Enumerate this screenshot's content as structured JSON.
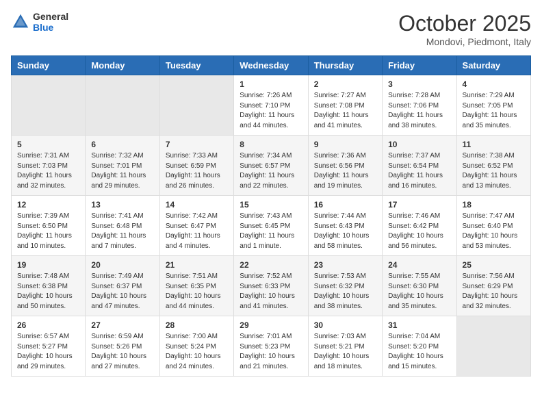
{
  "header": {
    "logo_general": "General",
    "logo_blue": "Blue",
    "month_title": "October 2025",
    "location": "Mondovi, Piedmont, Italy"
  },
  "days_of_week": [
    "Sunday",
    "Monday",
    "Tuesday",
    "Wednesday",
    "Thursday",
    "Friday",
    "Saturday"
  ],
  "weeks": [
    [
      {
        "num": "",
        "info": ""
      },
      {
        "num": "",
        "info": ""
      },
      {
        "num": "",
        "info": ""
      },
      {
        "num": "1",
        "info": "Sunrise: 7:26 AM\nSunset: 7:10 PM\nDaylight: 11 hours and 44 minutes."
      },
      {
        "num": "2",
        "info": "Sunrise: 7:27 AM\nSunset: 7:08 PM\nDaylight: 11 hours and 41 minutes."
      },
      {
        "num": "3",
        "info": "Sunrise: 7:28 AM\nSunset: 7:06 PM\nDaylight: 11 hours and 38 minutes."
      },
      {
        "num": "4",
        "info": "Sunrise: 7:29 AM\nSunset: 7:05 PM\nDaylight: 11 hours and 35 minutes."
      }
    ],
    [
      {
        "num": "5",
        "info": "Sunrise: 7:31 AM\nSunset: 7:03 PM\nDaylight: 11 hours and 32 minutes."
      },
      {
        "num": "6",
        "info": "Sunrise: 7:32 AM\nSunset: 7:01 PM\nDaylight: 11 hours and 29 minutes."
      },
      {
        "num": "7",
        "info": "Sunrise: 7:33 AM\nSunset: 6:59 PM\nDaylight: 11 hours and 26 minutes."
      },
      {
        "num": "8",
        "info": "Sunrise: 7:34 AM\nSunset: 6:57 PM\nDaylight: 11 hours and 22 minutes."
      },
      {
        "num": "9",
        "info": "Sunrise: 7:36 AM\nSunset: 6:56 PM\nDaylight: 11 hours and 19 minutes."
      },
      {
        "num": "10",
        "info": "Sunrise: 7:37 AM\nSunset: 6:54 PM\nDaylight: 11 hours and 16 minutes."
      },
      {
        "num": "11",
        "info": "Sunrise: 7:38 AM\nSunset: 6:52 PM\nDaylight: 11 hours and 13 minutes."
      }
    ],
    [
      {
        "num": "12",
        "info": "Sunrise: 7:39 AM\nSunset: 6:50 PM\nDaylight: 11 hours and 10 minutes."
      },
      {
        "num": "13",
        "info": "Sunrise: 7:41 AM\nSunset: 6:48 PM\nDaylight: 11 hours and 7 minutes."
      },
      {
        "num": "14",
        "info": "Sunrise: 7:42 AM\nSunset: 6:47 PM\nDaylight: 11 hours and 4 minutes."
      },
      {
        "num": "15",
        "info": "Sunrise: 7:43 AM\nSunset: 6:45 PM\nDaylight: 11 hours and 1 minute."
      },
      {
        "num": "16",
        "info": "Sunrise: 7:44 AM\nSunset: 6:43 PM\nDaylight: 10 hours and 58 minutes."
      },
      {
        "num": "17",
        "info": "Sunrise: 7:46 AM\nSunset: 6:42 PM\nDaylight: 10 hours and 56 minutes."
      },
      {
        "num": "18",
        "info": "Sunrise: 7:47 AM\nSunset: 6:40 PM\nDaylight: 10 hours and 53 minutes."
      }
    ],
    [
      {
        "num": "19",
        "info": "Sunrise: 7:48 AM\nSunset: 6:38 PM\nDaylight: 10 hours and 50 minutes."
      },
      {
        "num": "20",
        "info": "Sunrise: 7:49 AM\nSunset: 6:37 PM\nDaylight: 10 hours and 47 minutes."
      },
      {
        "num": "21",
        "info": "Sunrise: 7:51 AM\nSunset: 6:35 PM\nDaylight: 10 hours and 44 minutes."
      },
      {
        "num": "22",
        "info": "Sunrise: 7:52 AM\nSunset: 6:33 PM\nDaylight: 10 hours and 41 minutes."
      },
      {
        "num": "23",
        "info": "Sunrise: 7:53 AM\nSunset: 6:32 PM\nDaylight: 10 hours and 38 minutes."
      },
      {
        "num": "24",
        "info": "Sunrise: 7:55 AM\nSunset: 6:30 PM\nDaylight: 10 hours and 35 minutes."
      },
      {
        "num": "25",
        "info": "Sunrise: 7:56 AM\nSunset: 6:29 PM\nDaylight: 10 hours and 32 minutes."
      }
    ],
    [
      {
        "num": "26",
        "info": "Sunrise: 6:57 AM\nSunset: 5:27 PM\nDaylight: 10 hours and 29 minutes."
      },
      {
        "num": "27",
        "info": "Sunrise: 6:59 AM\nSunset: 5:26 PM\nDaylight: 10 hours and 27 minutes."
      },
      {
        "num": "28",
        "info": "Sunrise: 7:00 AM\nSunset: 5:24 PM\nDaylight: 10 hours and 24 minutes."
      },
      {
        "num": "29",
        "info": "Sunrise: 7:01 AM\nSunset: 5:23 PM\nDaylight: 10 hours and 21 minutes."
      },
      {
        "num": "30",
        "info": "Sunrise: 7:03 AM\nSunset: 5:21 PM\nDaylight: 10 hours and 18 minutes."
      },
      {
        "num": "31",
        "info": "Sunrise: 7:04 AM\nSunset: 5:20 PM\nDaylight: 10 hours and 15 minutes."
      },
      {
        "num": "",
        "info": ""
      }
    ]
  ]
}
